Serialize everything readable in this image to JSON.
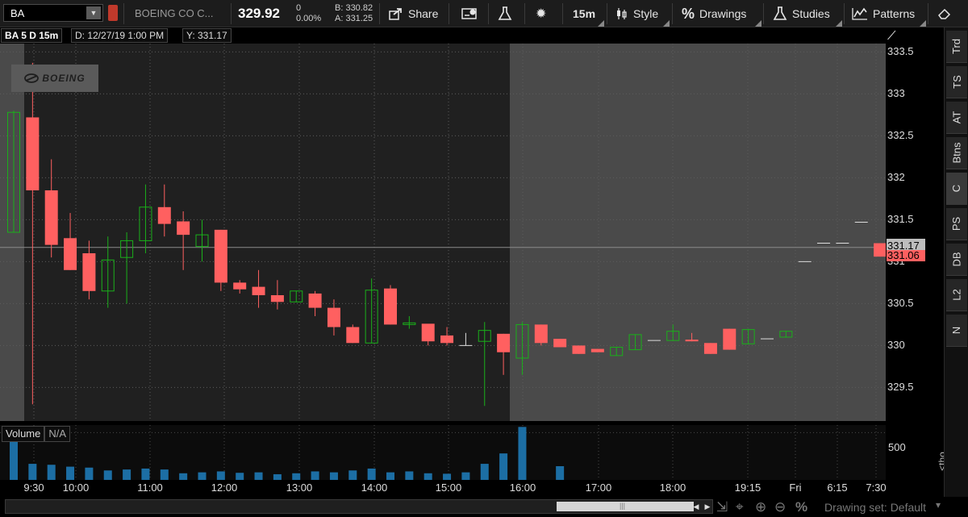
{
  "toolbar": {
    "symbol": "BA",
    "company": "BOEING CO C...",
    "last": "329.92",
    "net_change": "0",
    "pct_change": "0.00%",
    "bid": "B: 330.82",
    "ask": "A: 331.25",
    "share": "Share",
    "interval": "15m",
    "style": "Style",
    "drawings": "Drawings",
    "studies": "Studies",
    "patterns": "Patterns"
  },
  "chart_header": {
    "title": "BA 5 D 15m",
    "date": "D: 12/27/19 1:00 PM",
    "y": "Y: 331.17"
  },
  "logo": "BOEING",
  "price_badges": {
    "last": "331.17",
    "bid": "331.06"
  },
  "volume": {
    "label": "Volume",
    "value": "N/A",
    "axis_label": "500",
    "unit": "<tho..."
  },
  "bottom": {
    "drawing_set": "Drawing set: Default"
  },
  "right_tabs": [
    "Trd",
    "TS",
    "AT",
    "Btns",
    "C",
    "PS",
    "DB",
    "L2",
    "N"
  ],
  "colors": {
    "up": "#1ab01a",
    "down": "#ff6060",
    "neutral": "#dddddd",
    "volume": "#1c6ea4"
  },
  "chart_data": {
    "type": "candlestick",
    "ylim": [
      329.1,
      333.6
    ],
    "yticks": [
      "333.5",
      "333",
      "332.5",
      "332",
      "331.5",
      "331",
      "330.5",
      "330",
      "329.5"
    ],
    "xticks": [
      "9:30",
      "10:00",
      "11:00",
      "12:00",
      "13:00",
      "14:00",
      "15:00",
      "16:00",
      "17:00",
      "18:00",
      "19:15",
      "Fri",
      "6:15",
      "7:30"
    ],
    "reference_price": 331.17,
    "candles": [
      {
        "o": 331.35,
        "h": 332.8,
        "l": 331.35,
        "c": 332.78
      },
      {
        "o": 332.72,
        "h": 333.37,
        "l": 329.3,
        "c": 331.85
      },
      {
        "o": 331.85,
        "h": 332.22,
        "l": 331.05,
        "c": 331.2
      },
      {
        "o": 331.28,
        "h": 331.58,
        "l": 330.9,
        "c": 330.9
      },
      {
        "o": 331.1,
        "h": 331.25,
        "l": 330.55,
        "c": 330.65
      },
      {
        "o": 330.65,
        "h": 331.3,
        "l": 330.45,
        "c": 331.02
      },
      {
        "o": 331.05,
        "h": 331.35,
        "l": 330.5,
        "c": 331.25
      },
      {
        "o": 331.25,
        "h": 331.92,
        "l": 331.1,
        "c": 331.65
      },
      {
        "o": 331.65,
        "h": 331.92,
        "l": 331.3,
        "c": 331.45
      },
      {
        "o": 331.48,
        "h": 331.6,
        "l": 330.9,
        "c": 331.32
      },
      {
        "o": 331.18,
        "h": 331.5,
        "l": 331.0,
        "c": 331.32
      },
      {
        "o": 331.38,
        "h": 331.38,
        "l": 330.65,
        "c": 330.75
      },
      {
        "o": 330.75,
        "h": 330.78,
        "l": 330.62,
        "c": 330.67
      },
      {
        "o": 330.7,
        "h": 330.9,
        "l": 330.45,
        "c": 330.6
      },
      {
        "o": 330.6,
        "h": 330.78,
        "l": 330.43,
        "c": 330.52
      },
      {
        "o": 330.52,
        "h": 330.65,
        "l": 330.52,
        "c": 330.65
      },
      {
        "o": 330.62,
        "h": 330.65,
        "l": 330.35,
        "c": 330.45
      },
      {
        "o": 330.45,
        "h": 330.55,
        "l": 330.12,
        "c": 330.22
      },
      {
        "o": 330.22,
        "h": 330.25,
        "l": 330.03,
        "c": 330.03
      },
      {
        "o": 330.03,
        "h": 330.8,
        "l": 330.03,
        "c": 330.66
      },
      {
        "o": 330.68,
        "h": 330.72,
        "l": 330.25,
        "c": 330.25
      },
      {
        "o": 330.25,
        "h": 330.35,
        "l": 330.2,
        "c": 330.27
      },
      {
        "o": 330.26,
        "h": 330.25,
        "l": 330.0,
        "c": 330.05
      },
      {
        "o": 330.12,
        "h": 330.22,
        "l": 330.0,
        "c": 330.03
      },
      {
        "o": 330.0,
        "h": 330.15,
        "l": 330.0,
        "c": 330.0
      },
      {
        "o": 330.05,
        "h": 330.28,
        "l": 329.28,
        "c": 330.18
      },
      {
        "o": 330.14,
        "h": 330.14,
        "l": 329.65,
        "c": 329.92
      },
      {
        "o": 329.85,
        "h": 330.28,
        "l": 329.65,
        "c": 330.25
      },
      {
        "o": 330.25,
        "h": 330.25,
        "l": 330.0,
        "c": 330.03
      },
      {
        "o": 330.08,
        "h": 330.08,
        "l": 329.98,
        "c": 329.98
      },
      {
        "o": 330.0,
        "h": 330.0,
        "l": 329.9,
        "c": 329.9
      },
      {
        "o": 329.96,
        "h": 329.96,
        "l": 329.92,
        "c": 329.92
      },
      {
        "o": 329.88,
        "h": 329.98,
        "l": 329.88,
        "c": 329.98
      },
      {
        "o": 329.95,
        "h": 330.13,
        "l": 329.95,
        "c": 330.13
      },
      {
        "o": 330.06,
        "h": 330.06,
        "l": 330.06,
        "c": 330.06
      },
      {
        "o": 330.06,
        "h": 330.25,
        "l": 330.06,
        "c": 330.17
      },
      {
        "o": 330.07,
        "h": 330.15,
        "l": 330.05,
        "c": 330.05
      },
      {
        "o": 330.03,
        "h": 330.03,
        "l": 329.9,
        "c": 329.9
      },
      {
        "o": 330.2,
        "h": 330.2,
        "l": 329.95,
        "c": 329.95
      },
      {
        "o": 330.02,
        "h": 330.2,
        "l": 330.02,
        "c": 330.19
      },
      {
        "o": 330.08,
        "h": 330.08,
        "l": 330.08,
        "c": 330.08
      },
      {
        "o": 330.1,
        "h": 330.17,
        "l": 330.1,
        "c": 330.17
      },
      {
        "o": 331.0,
        "h": 331.0,
        "l": 331.0,
        "c": 331.0
      },
      {
        "o": 331.22,
        "h": 331.22,
        "l": 331.22,
        "c": 331.22
      },
      {
        "o": 331.22,
        "h": 331.22,
        "l": 331.22,
        "c": 331.22
      },
      {
        "o": 331.47,
        "h": 331.47,
        "l": 331.47,
        "c": 331.47
      },
      {
        "o": 331.22,
        "h": 331.22,
        "l": 331.06,
        "c": 331.06
      }
    ],
    "volume": {
      "ylim": [
        0,
        580
      ],
      "values": [
        430,
        170,
        160,
        140,
        130,
        100,
        110,
        120,
        110,
        70,
        80,
        90,
        75,
        80,
        60,
        70,
        90,
        80,
        100,
        120,
        80,
        90,
        70,
        65,
        80,
        170,
        280,
        560,
        0,
        145,
        0,
        0,
        0,
        0,
        0,
        0,
        0,
        0,
        0,
        0,
        0,
        0,
        0,
        0,
        0,
        0,
        0
      ]
    }
  }
}
